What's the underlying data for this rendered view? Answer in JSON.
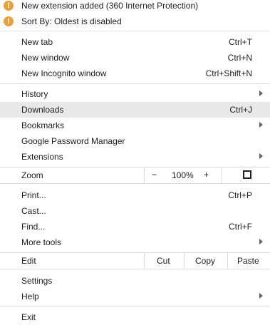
{
  "alerts": [
    {
      "icon": "!",
      "text": "New extension added (360 Internet Protection)"
    },
    {
      "icon": "!",
      "text": "Sort By: Oldest is disabled"
    }
  ],
  "menu": {
    "new_tab": {
      "label": "New tab",
      "shortcut": "Ctrl+T"
    },
    "new_window": {
      "label": "New window",
      "shortcut": "Ctrl+N"
    },
    "new_incognito": {
      "label": "New Incognito window",
      "shortcut": "Ctrl+Shift+N"
    },
    "history": {
      "label": "History"
    },
    "downloads": {
      "label": "Downloads",
      "shortcut": "Ctrl+J"
    },
    "bookmarks": {
      "label": "Bookmarks"
    },
    "password_manager": {
      "label": "Google Password Manager"
    },
    "extensions": {
      "label": "Extensions"
    },
    "zoom": {
      "label": "Zoom",
      "minus": "−",
      "level": "100%",
      "plus": "+"
    },
    "print": {
      "label": "Print...",
      "shortcut": "Ctrl+P"
    },
    "cast": {
      "label": "Cast..."
    },
    "find": {
      "label": "Find...",
      "shortcut": "Ctrl+F"
    },
    "more_tools": {
      "label": "More tools"
    },
    "edit": {
      "label": "Edit",
      "cut": "Cut",
      "copy": "Copy",
      "paste": "Paste"
    },
    "settings": {
      "label": "Settings"
    },
    "help": {
      "label": "Help"
    },
    "exit": {
      "label": "Exit"
    }
  }
}
